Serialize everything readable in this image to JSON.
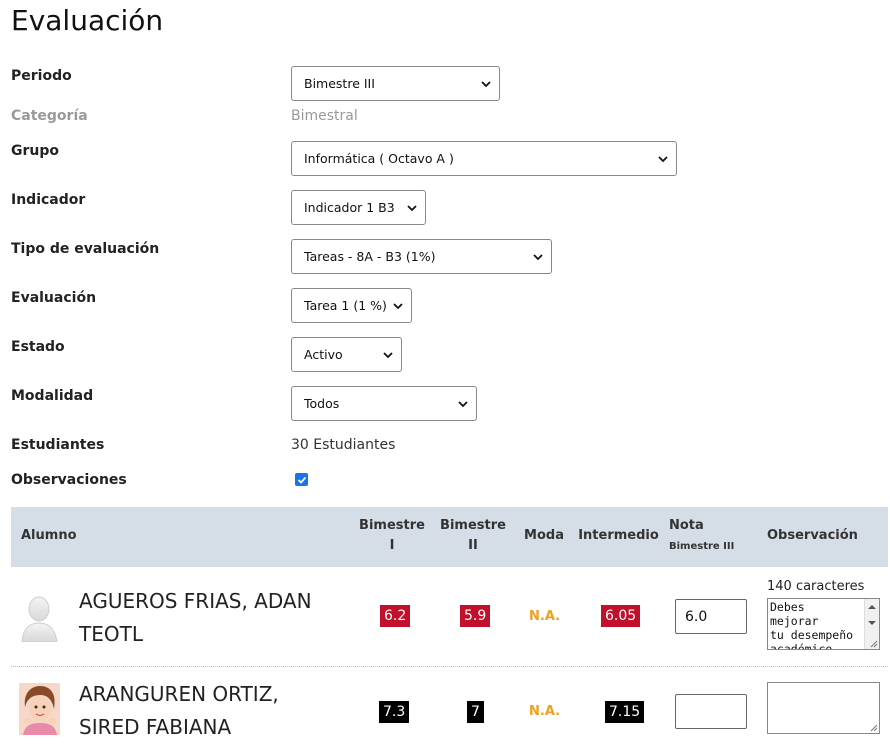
{
  "page": {
    "title": "Evaluación"
  },
  "form": {
    "periodo": {
      "label": "Periodo",
      "value": "Bimestre III"
    },
    "categoria": {
      "label": "Categoría",
      "value": "Bimestral"
    },
    "grupo": {
      "label": "Grupo",
      "value": "Informática ( Octavo A )"
    },
    "indicador": {
      "label": "Indicador",
      "value": "Indicador 1 B3"
    },
    "tipo": {
      "label": "Tipo de evaluación",
      "value": "Tareas - 8A - B3 (1%)"
    },
    "evaluacion": {
      "label": "Evaluación",
      "value": "Tarea 1 (1 %)"
    },
    "estado": {
      "label": "Estado",
      "value": "Activo"
    },
    "modalidad": {
      "label": "Modalidad",
      "value": "Todos"
    },
    "estudiantes": {
      "label": "Estudiantes",
      "value": "30 Estudiantes"
    },
    "observaciones": {
      "label": "Observaciones",
      "checked": true
    }
  },
  "table": {
    "headers": {
      "alumno": "Alumno",
      "b1_line1": "Bimestre",
      "b1_line2": "I",
      "b2_line1": "Bimestre",
      "b2_line2": "II",
      "moda": "Moda",
      "intermedio": "Intermedio",
      "nota": "Nota",
      "nota_sub": "Bimestre III",
      "observacion": "Observación"
    },
    "rows": [
      {
        "name_line1": "AGUEROS FRIAS, ADAN",
        "name_line2": "TEOTL",
        "b1": "6.2",
        "b2": "5.9",
        "moda": "N.A.",
        "intermedio": "6.05",
        "nota": "6.0",
        "char_count": "140 caracteres",
        "observacion_l1": "Debes mejorar",
        "observacion_l2": "tu desempeño",
        "observacion_l3": "académico,",
        "badge_color": "#c0102b"
      },
      {
        "name_line1": "ARANGUREN ORTIZ,",
        "name_line2": "SIRED FABIANA",
        "b1": "7.3",
        "b2": "7",
        "moda": "N.A.",
        "intermedio": "7.15",
        "nota": "",
        "observacion": "",
        "badge_color": "#000000"
      }
    ]
  },
  "colors": {
    "accent": "#1a73e8",
    "header_bg": "#d5dee6",
    "na": "#f0a020"
  }
}
